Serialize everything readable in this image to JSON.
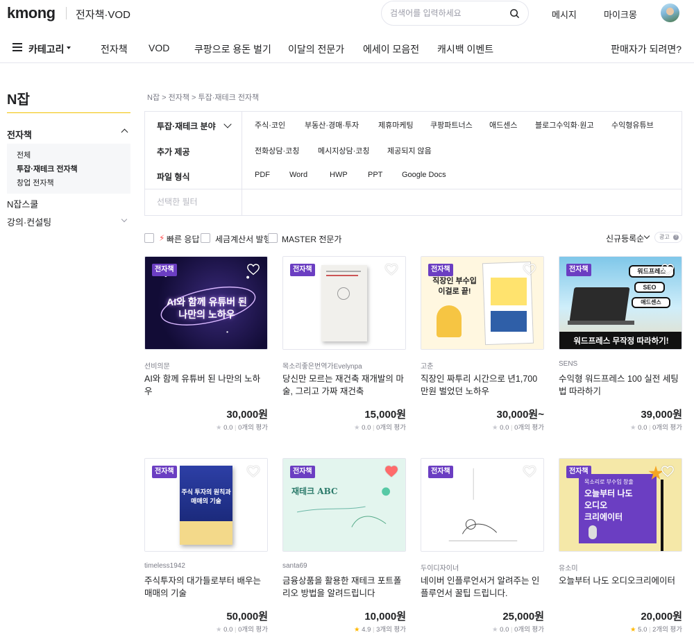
{
  "header": {
    "logo": "kmong",
    "section": "전자책·VOD",
    "search_placeholder": "검색어를 입력하세요",
    "messages": "메시지",
    "mykmong": "마이크몽"
  },
  "catnav": {
    "category": "카테고리",
    "items": [
      "전자책",
      "VOD",
      "쿠팡으로 용돈 벌기",
      "이달의 전문가",
      "에세이 모음전",
      "캐시백 이벤트"
    ],
    "seller": "판매자가 되려면?"
  },
  "sidebar": {
    "title": "N잡",
    "ebook": "전자책",
    "sub": [
      "전체",
      "투잡·재테크 전자책",
      "창업 전자책"
    ],
    "njob_school": "N잡스쿨",
    "lecture": "강의·컨설팅"
  },
  "breadcrumb": "N잡 > 전자책 > 투잡·재테크 전자책",
  "filters": {
    "field_label": "투잡·재테크 분야",
    "field_options": [
      "주식·코인",
      "부동산·경매·투자",
      "제휴마케팅",
      "쿠팡파트너스",
      "애드센스",
      "블로그수익화·원고",
      "수익형유튜브"
    ],
    "extra_label": "추가 제공",
    "extra_options": [
      "전화상담·코칭",
      "메시지상담·코칭",
      "제공되지 않음"
    ],
    "file_label": "파일 형식",
    "file_options": [
      "PDF",
      "Word",
      "HWP",
      "PPT",
      "Google Docs"
    ],
    "selected_label": "선택한 필터"
  },
  "options": {
    "fast": "빠른 응답",
    "tax": "세금계산서 발행",
    "master": "MASTER 전문가",
    "sort": "신규등록순",
    "ad": "광고"
  },
  "products": [
    {
      "tag": "전자책",
      "seller": "선비의문",
      "title": "AI와 함께 유튜버 된 나만의 노하우",
      "price": "30,000원",
      "score": "0.0",
      "reviews": "0개의 평가",
      "liked": false,
      "cover": "AI와 함께 유튜버 된\n나만의 노하우"
    },
    {
      "tag": "전자책",
      "seller": "목소리좋은번역가Evelynpa",
      "title": "당신만 모르는 재건축 재개발의 마술, 그리고 가짜 재건축",
      "price": "15,000원",
      "score": "0.0",
      "reviews": "0개의 평가",
      "liked": false
    },
    {
      "tag": "전자책",
      "seller": "고춘",
      "title": "직장인 짜투리 시간으로 년1,700만원 벌었던 노하우",
      "price": "30,000원~",
      "score": "0.0",
      "reviews": "0개의 평가",
      "liked": false,
      "cover": "직장인 부수입\n이걸로 끝!"
    },
    {
      "tag": "전자책",
      "seller": "SENS",
      "title": "수익형 워드프레스 100 실전 세팅법 따라하기",
      "price": "39,000원",
      "score": "0.0",
      "reviews": "0개의 평가",
      "liked": false,
      "cover": "워드프레스 무작정 따라하기!",
      "cover_badges": [
        "워드프레스",
        "SEO",
        "애드센스"
      ]
    },
    {
      "tag": "전자책",
      "seller": "timeless1942",
      "title": "주식투자의 대가들로부터 배우는 매매의 기술",
      "price": "50,000원",
      "score": "0.0",
      "reviews": "0개의 평가",
      "liked": false,
      "cover": "주식 투자의 원칙과\n매매의 기술"
    },
    {
      "tag": "전자책",
      "seller": "santa69",
      "title": "금융상품을 활용한 재테크 포트폴리오 방법을 알려드립니다",
      "price": "10,000원",
      "score": "4.9",
      "reviews": "3개의 평가",
      "liked": true,
      "cover": "재테크 ABC"
    },
    {
      "tag": "전자책",
      "seller": "두이디자이너",
      "title": "네이버 인플루언서거 알려주는 인플루언서 꿀팁 드립니다.",
      "price": "25,000원",
      "score": "0.0",
      "reviews": "0개의 평가",
      "liked": false
    },
    {
      "tag": "전자책",
      "seller": "유소미",
      "title": "오늘부터 나도 오디오크리에이터",
      "price": "20,000원",
      "score": "5.0",
      "reviews": "2개의 평가",
      "liked": false,
      "cover_kicker": "목소리로 부수입 창출",
      "cover": "오늘부터 나도\n오디오\n크리에이터"
    }
  ]
}
